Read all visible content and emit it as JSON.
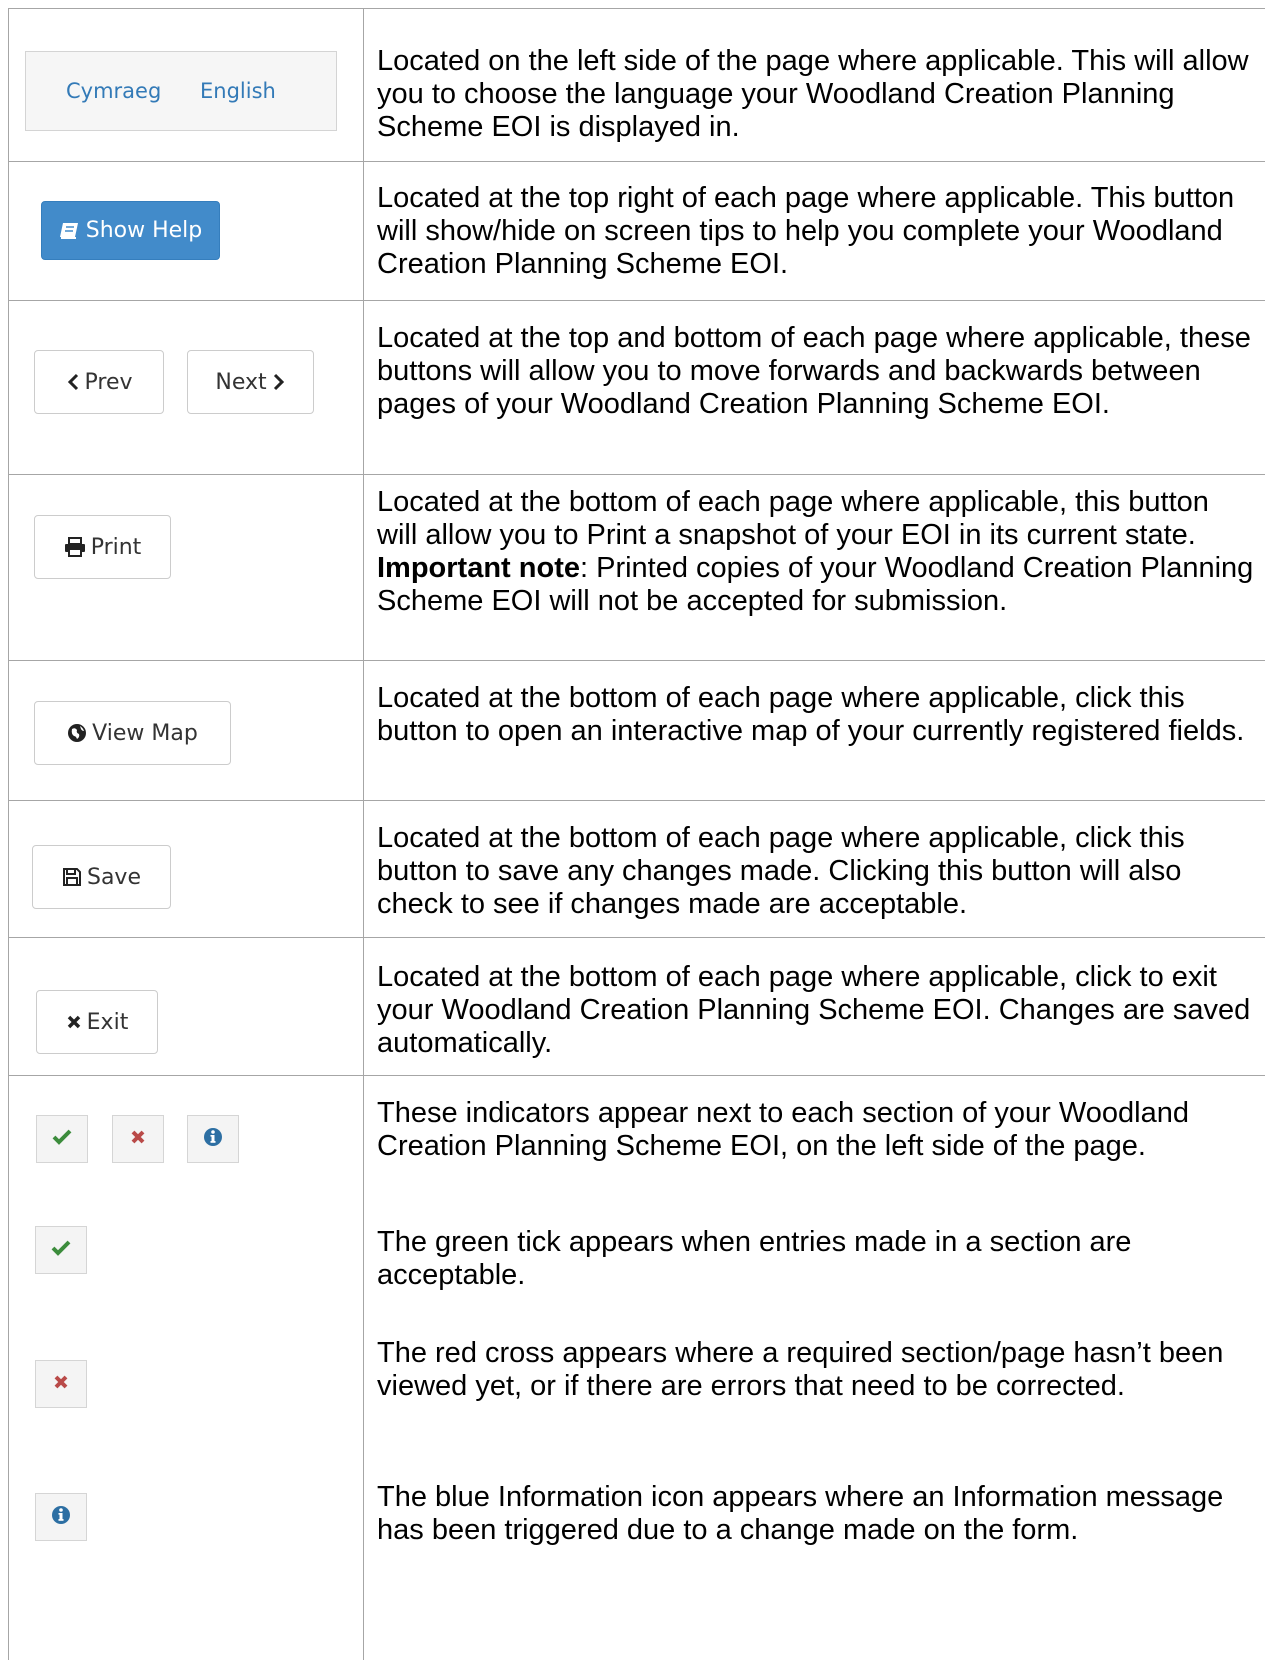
{
  "language_selector": {
    "welsh": "Cymraeg",
    "english": "English"
  },
  "buttons": {
    "show_help": "Show Help",
    "prev": "Prev",
    "next": "Next",
    "print": "Print",
    "view_map": "View Map",
    "save": "Save",
    "exit": "Exit"
  },
  "descriptions": {
    "language": "Located on the left side of the page where applicable. This will allow you to choose the language your Woodland Creation Planning Scheme EOI is displayed in.",
    "show_help": "Located at the top right of each page where applicable. This button will show/hide on screen tips to help you complete your Woodland Creation Planning Scheme EOI.",
    "navigation": "Located at the top and bottom of each page where applicable, these buttons will allow you to move forwards and backwards between pages of your Woodland Creation Planning Scheme EOI.",
    "print_main": "Located at the bottom of each page where applicable, this button will allow you to Print a snapshot of your EOI in its current state.",
    "print_note_label": "Important note",
    "print_note": ": Printed copies of your Woodland Creation Planning Scheme EOI will not be accepted for submission.",
    "view_map": "Located at the bottom of each page where applicable, click this button to open an interactive map of your currently registered fields.",
    "save": "Located at the bottom of each page where applicable, click this button to save any changes made. Clicking this button will also check to see if changes made are acceptable.",
    "exit": "Located at the bottom of each page where applicable, click to exit your Woodland Creation Planning Scheme EOI. Changes are saved automatically.",
    "indicators": "These indicators appear next to each section of your Woodland Creation Planning Scheme EOI, on the left side of the page.",
    "green_tick": "The green tick appears when entries made in a section are acceptable.",
    "red_cross": "The red cross appears where a required section/page hasn’t been viewed yet, or if there are errors that need to be corrected.",
    "info": "The blue Information icon appears where an Information message has been triggered due to a change made on the form."
  },
  "colors": {
    "link_blue": "#337ab7",
    "primary_button": "#428bca",
    "tick_green": "#3c8c3c",
    "cross_red": "#b94a48",
    "info_blue": "#2d6fa3",
    "border": "#a6a6a6"
  },
  "icons": {
    "show_help": "book-icon",
    "prev": "chevron-left-icon",
    "next": "chevron-right-icon",
    "print": "print-icon",
    "view_map": "globe-icon",
    "save": "floppy-disk-icon",
    "exit": "x-icon",
    "valid": "check-icon",
    "invalid": "x-icon",
    "information": "info-circle-icon"
  }
}
